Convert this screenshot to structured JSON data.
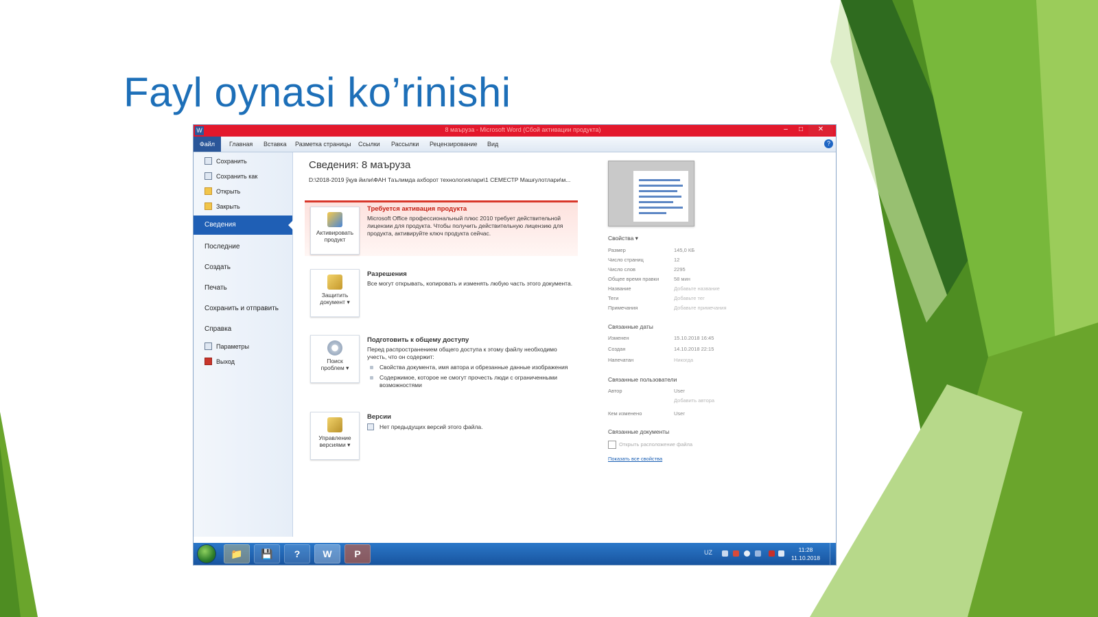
{
  "slide": {
    "title": "Fayl oynasi ko’rinishi"
  },
  "window": {
    "title": "8 маъруза - Microsoft Word (Сбой активации продукта)",
    "controls": {
      "minimize": "–",
      "maximize": "□",
      "close": "✕"
    }
  },
  "ribbon": {
    "tabs": [
      "Файл",
      "Главная",
      "Вставка",
      "Разметка страницы",
      "Ссылки",
      "Рассылки",
      "Рецензирование",
      "Вид"
    ],
    "help": "?"
  },
  "sidebar": {
    "top_items": [
      "Сохранить",
      "Сохранить как",
      "Открыть",
      "Закрыть"
    ],
    "active_item": "Сведения",
    "big_items": [
      "Последние",
      "Создать",
      "Печать",
      "Сохранить и отправить",
      "Справка"
    ],
    "bottom_items": [
      "Параметры",
      "Выход"
    ]
  },
  "info": {
    "title": "Сведения: 8 маъруза",
    "path": "D:\\2018-2019 ўқув йили\\ФАН Таълимда ахборот технологиялари\\1 СЕМЕСТР Машғулотлари\\м...",
    "activation": {
      "button": [
        "Активировать",
        "продукт"
      ],
      "heading": "Требуется активация продукта",
      "text": "Microsoft Office профессиональный плюс 2010 требует действительной лицензии для продукта. Чтобы получить действительную лицензию для продукта, активируйте ключ продукта сейчас."
    },
    "permissions": {
      "button": [
        "Защитить",
        "документ ▾"
      ],
      "heading": "Разрешения",
      "text": "Все могут открывать, копировать и изменять любую часть этого документа."
    },
    "prepare": {
      "button": [
        "Поиск",
        "проблем ▾"
      ],
      "heading": "Подготовить к общему доступу",
      "text": "Перед распространением общего доступа к этому файлу необходимо учесть, что он содержит:",
      "bullets": [
        "Свойства документа, имя автора и обрезанные данные изображения",
        "Содержимое, которое не смогут прочесть люди с ограниченными возможностями"
      ]
    },
    "versions": {
      "button": [
        "Управление",
        "версиями ▾"
      ],
      "heading": "Версии",
      "text": "Нет предыдущих версий этого файла."
    }
  },
  "properties": {
    "header": "Свойства ▾",
    "rows": [
      {
        "key": "Размер",
        "value": "145,0 КБ"
      },
      {
        "key": "Число страниц",
        "value": "12"
      },
      {
        "key": "Число слов",
        "value": "2295"
      },
      {
        "key": "Общее время правки",
        "value": "58 мин"
      },
      {
        "key": "Название",
        "value": "Добавьте название"
      },
      {
        "key": "Теги",
        "value": "Добавьте тег"
      },
      {
        "key": "Примечания",
        "value": "Добавьте примечания"
      }
    ],
    "dates_header": "Связанные даты",
    "dates": [
      {
        "key": "Изменен",
        "value": "15.10.2018 16:45"
      },
      {
        "key": "Создан",
        "value": "14.10.2018 22:15"
      },
      {
        "key": "Напечатан",
        "value": "Никогда"
      }
    ],
    "people_header": "Связанные пользователи",
    "people": [
      {
        "key": "Автор",
        "value": "User"
      },
      {
        "key": "",
        "value": "Добавить автора"
      },
      {
        "key": "Кем изменено",
        "value": "User"
      }
    ],
    "docs_header": "Связанные документы",
    "open_location": "Открыть расположение файла",
    "show_all": "Показать все свойства"
  },
  "taskbar": {
    "apps": [
      "📁",
      "💾",
      "?",
      "W",
      "P"
    ],
    "lang": "UZ",
    "time": "11:28",
    "date": "11.10.2018"
  },
  "colors": {
    "title_blue": "#1d6fb8",
    "titlebar_red": "#e3182c",
    "file_tab": "#2a5699",
    "sidebar_active": "#1f5fb5",
    "alert_red": "#c41e12",
    "green_accent": "#5fae24"
  }
}
